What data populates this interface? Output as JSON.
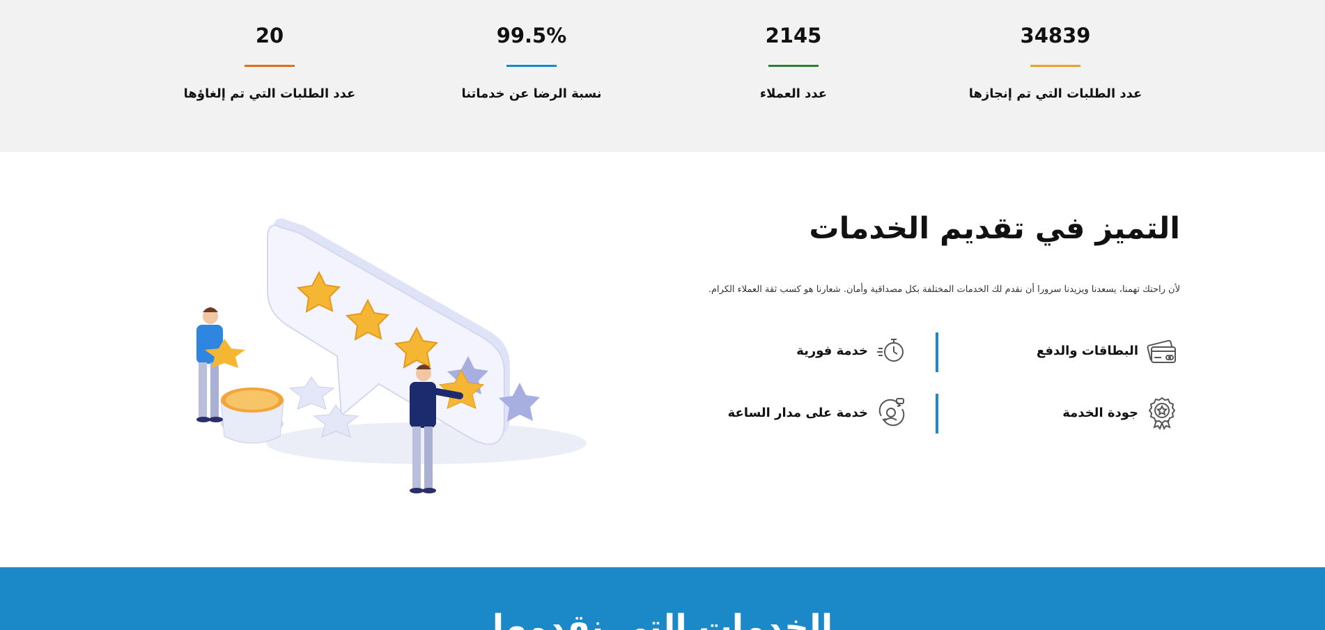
{
  "stats": [
    {
      "value": "34839",
      "label": "عدد الطلبات التي تم إنجازها",
      "color": "#e8a228"
    },
    {
      "value": "2145",
      "label": "عدد العملاء",
      "color": "#2e7d32"
    },
    {
      "value": "99.5%",
      "label": "نسبة الرضا عن خدماتنا",
      "color": "#1b89c8"
    },
    {
      "value": "20",
      "label": "عدد الطلبات التي تم إلغاؤها",
      "color": "#d9701e"
    }
  ],
  "features": {
    "title": "التميز في تقديم الخدمات",
    "description": "لأن راحتك تهمنا، يسعدنا ويزيدنا سرورا أن نقدم لك الخدمات المختلفة بكل مصداقية وأمان. شعارنا هو كسب ثقة العملاء الكرام.",
    "items": [
      {
        "label": "البطاقات والدفع",
        "icon": "credit-card-icon"
      },
      {
        "label": "خدمة فورية",
        "icon": "stopwatch-icon"
      },
      {
        "label": "جودة الخدمة",
        "icon": "award-badge-icon"
      },
      {
        "label": "خدمة على مدار الساعة",
        "icon": "support-agent-icon"
      }
    ],
    "accent": "#1b89c8"
  },
  "services": {
    "title": "الخدمات التي نقدمها",
    "background": "#1b89c8"
  }
}
